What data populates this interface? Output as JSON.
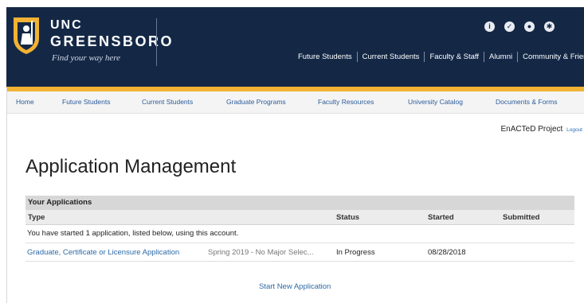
{
  "brand": {
    "line1": "UNC",
    "line2": "GREENSBORO",
    "tagline": "Find your way here"
  },
  "utility_icons": [
    "info-icon",
    "checkmark-icon",
    "person-icon",
    "gear-icon"
  ],
  "top_nav": [
    "Future Students",
    "Current Students",
    "Faculty & Staff",
    "Alumni",
    "Community & Friends"
  ],
  "sub_nav": [
    "Home",
    "Future Students",
    "Current Students",
    "Graduate Programs",
    "Faculty Resources",
    "University Catalog",
    "Documents & Forms"
  ],
  "user_bar": {
    "project": "EnACTeD Project",
    "logout": "Logout"
  },
  "page_title": "Application Management",
  "applications": {
    "caption": "Your Applications",
    "columns": [
      "Type",
      "Status",
      "Started",
      "Submitted"
    ],
    "info": "You have started 1 application, listed below, using this account.",
    "rows": [
      {
        "type": "Graduate, Certificate or Licensure Application",
        "term": "Spring 2019 - No Major Selec...",
        "status": "In Progress",
        "started": "08/28/2018",
        "submitted": ""
      }
    ]
  },
  "start_new": "Start New Application",
  "colors": {
    "header_navy": "#142846",
    "accent_gold": "#f2b233",
    "link_blue": "#2d6aa6"
  }
}
